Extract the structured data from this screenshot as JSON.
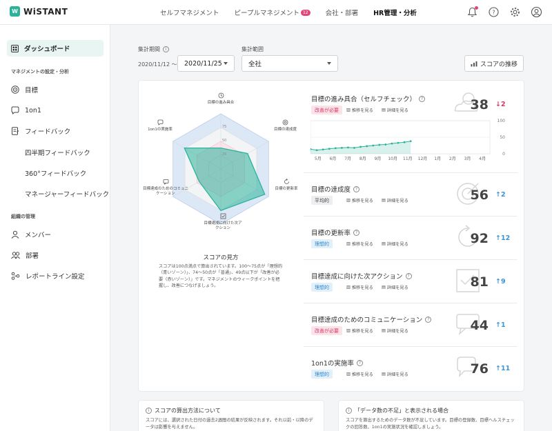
{
  "app": {
    "logo": "WiSTANT",
    "logo_mark": "W"
  },
  "topnav": {
    "items": [
      "セルフマネジメント",
      "ピープルマネジメント",
      "会社・部署",
      "HR管理・分析"
    ],
    "badge": "12"
  },
  "sidebar": {
    "dashboard": "ダッシュボード",
    "section_management": "マネジメントの設定・分析",
    "goal": "目標",
    "one_on_one": "1on1",
    "feedback": "フィードバック",
    "feedback_subs": [
      "四半期フィードバック",
      "360°フィードバック",
      "マネージャーフィードバック"
    ],
    "section_org": "組織の管理",
    "members": "メンバー",
    "departments": "部署",
    "report_line": "レポートライン設定"
  },
  "filters": {
    "period_label": "集計期間",
    "period_start": "2020/11/12 〜",
    "period_end": "2020/11/25",
    "scope_label": "集計範囲",
    "scope_value": "全社",
    "trend_button": "スコアの推移"
  },
  "radar": {
    "axes": [
      "目標の進み具合",
      "目標の達成度",
      "目標の更新率",
      "目標達成に向けた次アクション",
      "目標達成のためのコミュニケーション",
      "1on1の実施率"
    ],
    "scale_labels": [
      "75",
      "50",
      "25"
    ],
    "howto_title": "スコアの見方",
    "howto_text": "スコアは100点満点で算出されています。100〜75点が「理想的（青いゾーン）」、74〜50点が「普通」、49点以下が「改善が必要（赤いゾーン）」です。マネジメントのウィークポイントを把握し、改善につなげましょう。"
  },
  "links": {
    "trend": "推移を見る",
    "detail": "詳細を見る"
  },
  "metrics": [
    {
      "title": "目標の進み具合（セルフチェック）",
      "tag": "改善が必要",
      "tag_type": "bad",
      "score": "38",
      "delta": "↓2",
      "dir": "down"
    },
    {
      "title": "目標の達成度",
      "tag": "平均的",
      "tag_type": "avg",
      "score": "56",
      "delta": "↑2",
      "dir": "up"
    },
    {
      "title": "目標の更新率",
      "tag": "理想的",
      "tag_type": "good",
      "score": "92",
      "delta": "↑12",
      "dir": "up"
    },
    {
      "title": "目標達成に向けた次アクション",
      "tag": "理想的",
      "tag_type": "good",
      "score": "81",
      "delta": "↑9",
      "dir": "up"
    },
    {
      "title": "目標達成のためのコミュニケーション",
      "tag": "改善が必要",
      "tag_type": "bad",
      "score": "44",
      "delta": "↑1",
      "dir": "up"
    },
    {
      "title": "1on1の実施率",
      "tag": "理想的",
      "tag_type": "good",
      "score": "76",
      "delta": "↑11",
      "dir": "up"
    }
  ],
  "chart_data": {
    "type": "area",
    "categories": [
      "5月",
      "6月",
      "7月",
      "8月",
      "9月",
      "10月",
      "11月",
      "12月",
      "1月",
      "2月",
      "3月",
      "4月"
    ],
    "y_ticks": [
      "100",
      "50",
      "0"
    ],
    "ylim": [
      0,
      100
    ],
    "values": [
      14,
      11,
      13,
      15,
      17,
      18,
      19,
      18,
      21,
      23,
      25,
      27,
      28,
      31,
      33,
      35,
      38
    ],
    "x_start": 0,
    "x_end": 6.7
  },
  "info_cards": [
    {
      "title": "スコアの算出方法について",
      "text": "スコアには、選択された日付の過去2週間の結果が反映されます。それ以前・以降のデータは影響を与えません。"
    },
    {
      "title": "「データ数の不足」と表示される場合",
      "text": "スコアを算出するためのデータ数が不足しています。目標の登録数、目標ヘルスチェックの回答数、1on1の実施状況を確認しましょう。"
    }
  ],
  "colors": {
    "brand": "#2bb39a",
    "bad": "#d63865",
    "good": "#3b94d6"
  }
}
